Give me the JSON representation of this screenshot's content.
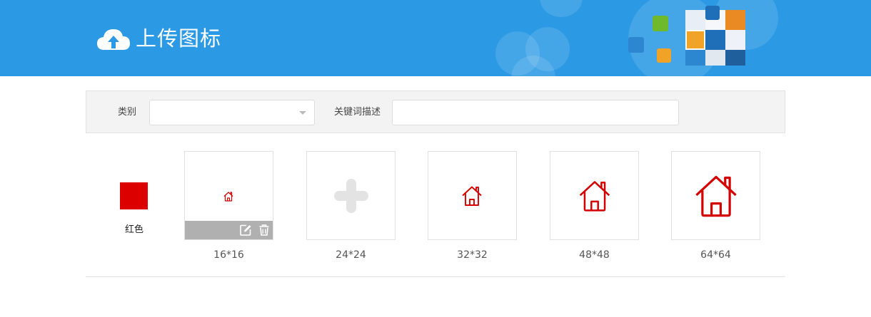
{
  "header": {
    "title": "上传图标",
    "logo_icon": "cloud-upload-icon",
    "background_color": "#2b99e4"
  },
  "filter": {
    "category_label": "类别",
    "category_value": "",
    "keyword_label": "关键词描述",
    "keyword_value": ""
  },
  "color": {
    "label": "红色",
    "value": "#dd0000"
  },
  "icons": [
    {
      "size_label": "16*16",
      "state": "uploaded",
      "icon": "house-icon"
    },
    {
      "size_label": "24*24",
      "state": "empty",
      "icon": "plus-icon"
    },
    {
      "size_label": "32*32",
      "state": "uploaded",
      "icon": "house-icon"
    },
    {
      "size_label": "48*48",
      "state": "uploaded",
      "icon": "house-icon"
    },
    {
      "size_label": "64*64",
      "state": "uploaded",
      "icon": "house-icon"
    }
  ],
  "toolbar": {
    "edit_icon": "edit-icon",
    "delete_icon": "trash-icon"
  }
}
